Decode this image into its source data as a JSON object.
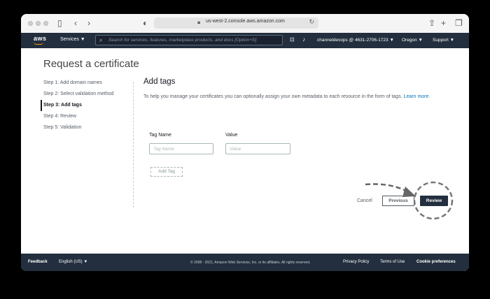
{
  "browser": {
    "url": "us-west-2.console.aws.amazon.com"
  },
  "nav": {
    "logo": "aws",
    "services": "Services ▼",
    "search_placeholder": "Search for services, features, marketplace products, and docs  [Option+S]",
    "account": "channeldevops @ 4631-2706-1723 ▼",
    "region": "Oregon ▼",
    "support": "Support ▼"
  },
  "page": {
    "title": "Request a certificate",
    "steps": [
      {
        "label": "Step 1: Add domain names",
        "active": false
      },
      {
        "label": "Step 2: Select validation method",
        "active": false
      },
      {
        "label": "Step 3: Add tags",
        "active": true
      },
      {
        "label": "Step 4: Review",
        "active": false
      },
      {
        "label": "Step 5: Validation",
        "active": false
      }
    ],
    "section_title": "Add tags",
    "description": "To help you manage your certificates you can optionally assign your own metadata to each resource in the form of tags.",
    "learn_more": "Learn more.",
    "tag_name_label": "Tag Name",
    "value_label": "Value",
    "tag_name_placeholder": "Tag Name",
    "value_placeholder": "Value",
    "add_tag": "Add Tag",
    "cancel": "Cancel",
    "previous": "Previous",
    "review": "Review"
  },
  "footer": {
    "feedback": "Feedback",
    "language": "English (US) ▼",
    "copyright": "© 2008 - 2021, Amazon Web Services, Inc. or its affiliates. All rights reserved.",
    "privacy": "Privacy Policy",
    "terms": "Terms of Use",
    "cookies": "Cookie preferences"
  },
  "colors": {
    "nav_bg": "#232f3e",
    "accent": "#ff9900",
    "link": "#0073bb"
  }
}
